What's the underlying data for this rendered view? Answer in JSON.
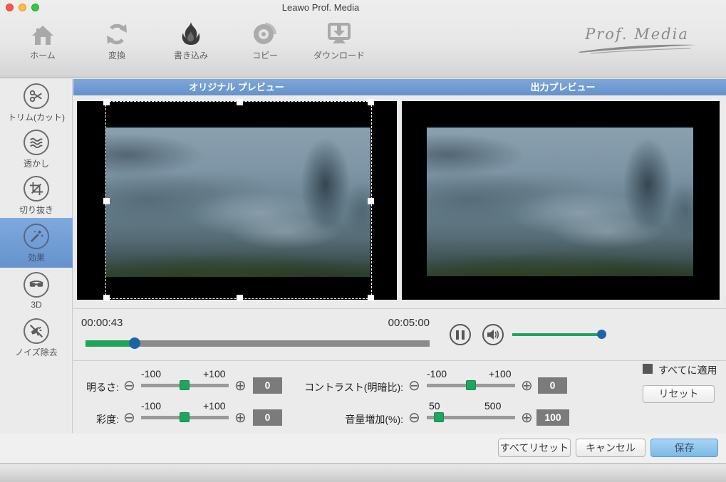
{
  "window": {
    "title": "Leawo Prof. Media",
    "logo_text": "Prof. Media"
  },
  "toolbar": {
    "items": [
      {
        "label": "ホーム",
        "icon": "home-icon"
      },
      {
        "label": "変換",
        "icon": "convert-icon"
      },
      {
        "label": "書き込み",
        "icon": "burn-icon",
        "active": true
      },
      {
        "label": "コピー",
        "icon": "copy-icon"
      },
      {
        "label": "ダウンロード",
        "icon": "download-icon"
      }
    ]
  },
  "sidebar": {
    "items": [
      {
        "label": "トリム(カット)",
        "icon": "scissors-icon",
        "selected": false
      },
      {
        "label": "透かし",
        "icon": "watermark-waves-icon",
        "selected": false
      },
      {
        "label": "切り抜き",
        "icon": "crop-icon",
        "selected": false
      },
      {
        "label": "効果",
        "icon": "effect-wand-icon",
        "selected": true
      },
      {
        "label": "3D",
        "icon": "3d-glasses-icon",
        "selected": false
      },
      {
        "label": "ノイズ除去",
        "icon": "noise-removal-icon",
        "selected": false
      }
    ]
  },
  "preview": {
    "original_title": "オリジナル プレビュー",
    "output_title": "出力プレビュー"
  },
  "player": {
    "current_time": "00:00:43",
    "total_time": "00:05:00",
    "progress_percent": 14.3,
    "volume_percent": 95
  },
  "adjustments": {
    "brightness": {
      "label": "明るさ:",
      "min": "-100",
      "max": "+100",
      "value": "0",
      "slider_percent": 50
    },
    "saturation": {
      "label": "彩度:",
      "min": "-100",
      "max": "+100",
      "value": "0",
      "slider_percent": 50
    },
    "contrast": {
      "label": "コントラスト(明暗比):",
      "min": "-100",
      "max": "+100",
      "value": "0",
      "slider_percent": 50
    },
    "volume_gain": {
      "label": "音量増加(%):",
      "min": "50",
      "max": "500",
      "value": "100",
      "slider_percent": 13
    }
  },
  "effects_panel": {
    "apply_all_label": "すべてに適用",
    "reset_label": "リセット"
  },
  "footer_buttons": {
    "reset_all": "すべてリセット",
    "cancel": "キャンセル",
    "save": "保存"
  },
  "colors": {
    "accent_blue_header": "#6f9cd2",
    "selected_sidebar_blue": "#6f9fd6",
    "slider_green": "#1ea55b",
    "thumb_blue": "#1c64a8",
    "value_box_gray": "#7b7b7b",
    "save_button_blue": "#8cc3ec"
  }
}
